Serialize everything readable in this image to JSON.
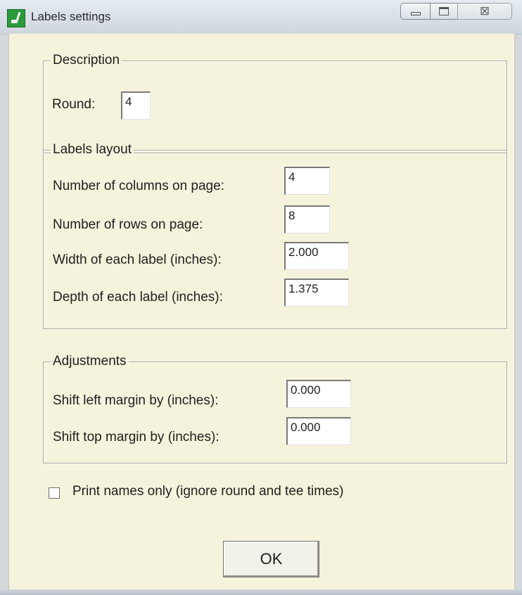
{
  "window": {
    "title": "Labels settings",
    "icon": "app-icon",
    "controls": [
      "minimize-icon",
      "maximize-icon",
      "close-icon"
    ],
    "close_glyph": "⊠"
  },
  "description_group": {
    "legend": "Description",
    "round_label": "Round:",
    "round_value": "4"
  },
  "layout_group": {
    "legend": "Labels layout",
    "columns_label": "Number of columns on page:",
    "columns_value": "4",
    "rows_label": "Number of rows on page:",
    "rows_value": "8",
    "width_label": "Width of each label (inches):",
    "width_value": "2.000",
    "depth_label": "Depth of each label (inches):",
    "depth_value": "1.375"
  },
  "adjustments_group": {
    "legend": "Adjustments",
    "left_margin_label": "Shift left margin by (inches):",
    "left_margin_value": "0.000",
    "top_margin_label": "Shift top margin by (inches):",
    "top_margin_value": "0.000"
  },
  "print_names_only": {
    "label": "Print names only (ignore round and tee times)",
    "checked": false
  },
  "ok_button": {
    "label": "OK"
  },
  "colors": {
    "client_background": "#f5f3dc",
    "titlebar": "#dfe5ec",
    "group_border": "#a9a89a"
  }
}
